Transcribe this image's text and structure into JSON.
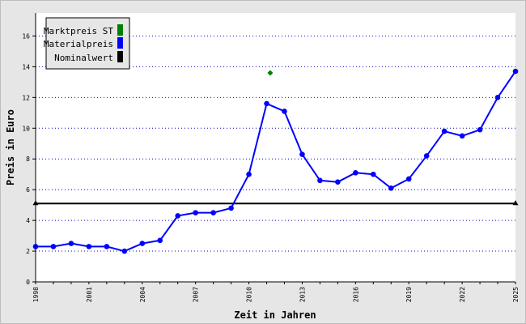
{
  "chart_data": {
    "type": "line",
    "title": "",
    "xlabel": "Zeit in Jahren",
    "ylabel": "Preis in Euro",
    "xlim": [
      1998,
      2025
    ],
    "ylim": [
      0,
      17.5
    ],
    "y_ticks": [
      0,
      2,
      4,
      6,
      8,
      10,
      12,
      14,
      16
    ],
    "x_ticks": [
      1998,
      2001,
      2004,
      2007,
      2010,
      2013,
      2016,
      2019,
      2022,
      2025
    ],
    "grid": "horizontal dotted",
    "legend_position": "top-left",
    "series": [
      {
        "name": "Marktpreis ST",
        "color": "#008000",
        "marker": "diamond",
        "x": [
          2011.2
        ],
        "y": [
          13.6
        ]
      },
      {
        "name": "Materialpreis",
        "color": "#0000ff",
        "marker": "circle",
        "x": [
          1998,
          1999,
          2000,
          2001,
          2002,
          2003,
          2004,
          2005,
          2006,
          2007,
          2008,
          2009,
          2010,
          2011,
          2012,
          2013,
          2014,
          2015,
          2016,
          2017,
          2018,
          2019,
          2020,
          2021,
          2022,
          2023,
          2024,
          2025
        ],
        "y": [
          2.3,
          2.3,
          2.5,
          2.3,
          2.3,
          2.0,
          2.5,
          2.7,
          4.3,
          4.5,
          4.5,
          4.8,
          7.0,
          11.6,
          11.1,
          8.3,
          6.6,
          6.5,
          7.1,
          7.0,
          6.1,
          6.7,
          8.2,
          9.8,
          9.5,
          9.9,
          12.0,
          13.7
        ]
      },
      {
        "name": "Nominalwert",
        "color": "#000000",
        "marker": "triangle",
        "x": [
          1998,
          2025
        ],
        "y": [
          5.1,
          5.1
        ]
      }
    ]
  }
}
